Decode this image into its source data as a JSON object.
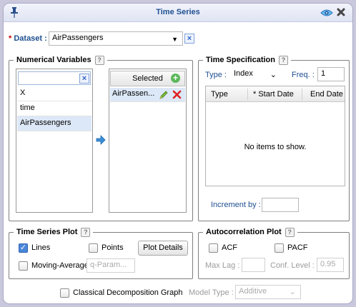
{
  "window": {
    "title": "Time Series"
  },
  "dataset": {
    "label": "Dataset :",
    "required_mark": "*",
    "value": "AirPassengers"
  },
  "numerical_variables": {
    "title": "Numerical Variables",
    "help": "?",
    "search_value": "",
    "available": [
      "X",
      "time",
      "AirPassengers"
    ],
    "selected_header": "Selected",
    "selected_items": [
      "AirPassen..."
    ]
  },
  "time_specification": {
    "title": "Time Specification",
    "help": "?",
    "type_label": "Type :",
    "type_value": "Index",
    "freq_label": "Freq. :",
    "freq_value": "1",
    "columns": [
      "Type",
      "* Start Date",
      "End Date"
    ],
    "empty_text": "No items to show.",
    "increment_label": "Increment by :",
    "increment_value": ""
  },
  "time_series_plot": {
    "title": "Time Series Plot",
    "help": "?",
    "lines_label": "Lines",
    "lines_checked": true,
    "points_label": "Points",
    "points_checked": false,
    "plot_details_label": "Plot Details",
    "moving_average_label": "Moving-Average",
    "moving_average_checked": false,
    "q_param_placeholder": "q-Param..."
  },
  "autocorrelation_plot": {
    "title": "Autocorrelation Plot",
    "help": "?",
    "acf_label": "ACF",
    "pacf_label": "PACF",
    "max_lag_label": "Max Lag :",
    "max_lag_value": "",
    "conf_level_label": "Conf. Level :",
    "conf_level_value": "0.95"
  },
  "bottom": {
    "classical_label": "Classical Decomposition Graph",
    "model_type_label": "Model Type :",
    "model_type_value": "Additive"
  },
  "icons": {
    "pin": "pin-icon",
    "eye": "eye-icon",
    "close": "close-icon",
    "arrow": "arrow-right-icon",
    "edit": "pencil-icon",
    "delete": "delete-icon",
    "add": "add-icon"
  },
  "colors": {
    "title": "#1d4f91",
    "accent": "#2d63c8",
    "selected_row": "#dce8f7",
    "required": "#cc0000"
  }
}
